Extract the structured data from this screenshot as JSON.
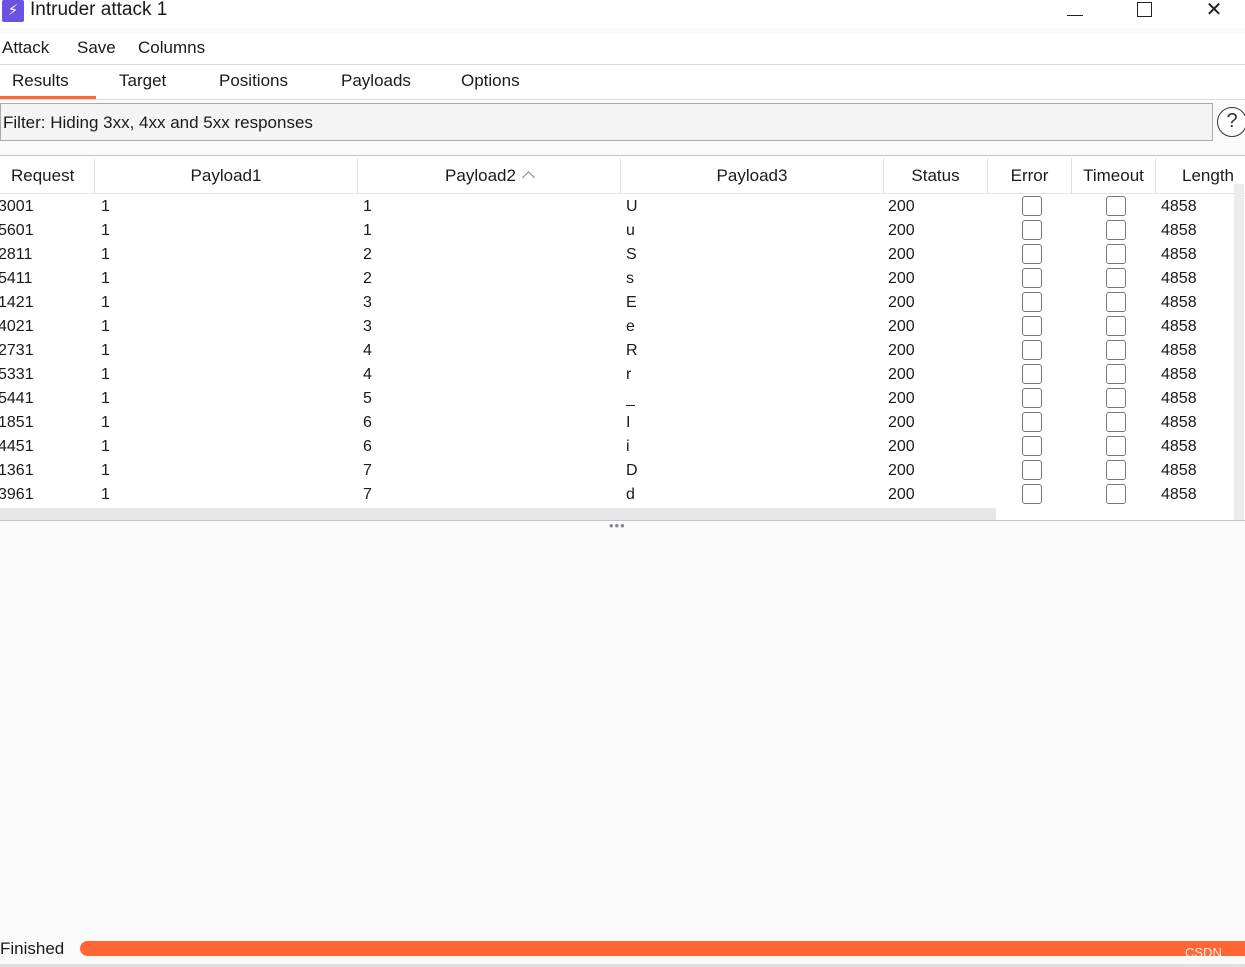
{
  "window": {
    "title": "Intruder attack 1",
    "app_icon": "lightning-icon",
    "controls": {
      "minimize": "minimize-icon",
      "maximize": "maximize-icon",
      "close": "✕"
    }
  },
  "menu": {
    "items": [
      {
        "label": "Attack"
      },
      {
        "label": "Save"
      },
      {
        "label": "Columns"
      }
    ]
  },
  "tabs": {
    "items": [
      {
        "label": "Results",
        "active": true
      },
      {
        "label": "Target",
        "active": false
      },
      {
        "label": "Positions",
        "active": false
      },
      {
        "label": "Payloads",
        "active": false
      },
      {
        "label": "Options",
        "active": false
      }
    ],
    "accent_color": "#ff6633"
  },
  "filter": {
    "text": "Filter: Hiding 3xx, 4xx and 5xx responses",
    "help_label": "?"
  },
  "table": {
    "columns": [
      "Request",
      "Payload1",
      "Payload2",
      "Payload3",
      "Status",
      "Error",
      "Timeout",
      "Length"
    ],
    "sorted_column": "Payload2",
    "sort_direction": "ascending",
    "rows": [
      {
        "request": "3001",
        "payload1": "1",
        "payload2": "1",
        "payload3": "U",
        "status": "200",
        "error": false,
        "timeout": false,
        "length": "4858"
      },
      {
        "request": "5601",
        "payload1": "1",
        "payload2": "1",
        "payload3": "u",
        "status": "200",
        "error": false,
        "timeout": false,
        "length": "4858"
      },
      {
        "request": "2811",
        "payload1": "1",
        "payload2": "2",
        "payload3": "S",
        "status": "200",
        "error": false,
        "timeout": false,
        "length": "4858"
      },
      {
        "request": "5411",
        "payload1": "1",
        "payload2": "2",
        "payload3": "s",
        "status": "200",
        "error": false,
        "timeout": false,
        "length": "4858"
      },
      {
        "request": "1421",
        "payload1": "1",
        "payload2": "3",
        "payload3": "E",
        "status": "200",
        "error": false,
        "timeout": false,
        "length": "4858"
      },
      {
        "request": "4021",
        "payload1": "1",
        "payload2": "3",
        "payload3": "e",
        "status": "200",
        "error": false,
        "timeout": false,
        "length": "4858"
      },
      {
        "request": "2731",
        "payload1": "1",
        "payload2": "4",
        "payload3": "R",
        "status": "200",
        "error": false,
        "timeout": false,
        "length": "4858"
      },
      {
        "request": "5331",
        "payload1": "1",
        "payload2": "4",
        "payload3": "r",
        "status": "200",
        "error": false,
        "timeout": false,
        "length": "4858"
      },
      {
        "request": "5441",
        "payload1": "1",
        "payload2": "5",
        "payload3": "_",
        "status": "200",
        "error": false,
        "timeout": false,
        "length": "4858"
      },
      {
        "request": "1851",
        "payload1": "1",
        "payload2": "6",
        "payload3": "I",
        "status": "200",
        "error": false,
        "timeout": false,
        "length": "4858"
      },
      {
        "request": "4451",
        "payload1": "1",
        "payload2": "6",
        "payload3": "i",
        "status": "200",
        "error": false,
        "timeout": false,
        "length": "4858"
      },
      {
        "request": "1361",
        "payload1": "1",
        "payload2": "7",
        "payload3": "D",
        "status": "200",
        "error": false,
        "timeout": false,
        "length": "4858"
      },
      {
        "request": "3961",
        "payload1": "1",
        "payload2": "7",
        "payload3": "d",
        "status": "200",
        "error": false,
        "timeout": false,
        "length": "4858"
      }
    ]
  },
  "status": {
    "text": "Finished",
    "progress": 1.0,
    "progress_color": "#ff6633",
    "watermark": "CSDN @NetDefend"
  }
}
